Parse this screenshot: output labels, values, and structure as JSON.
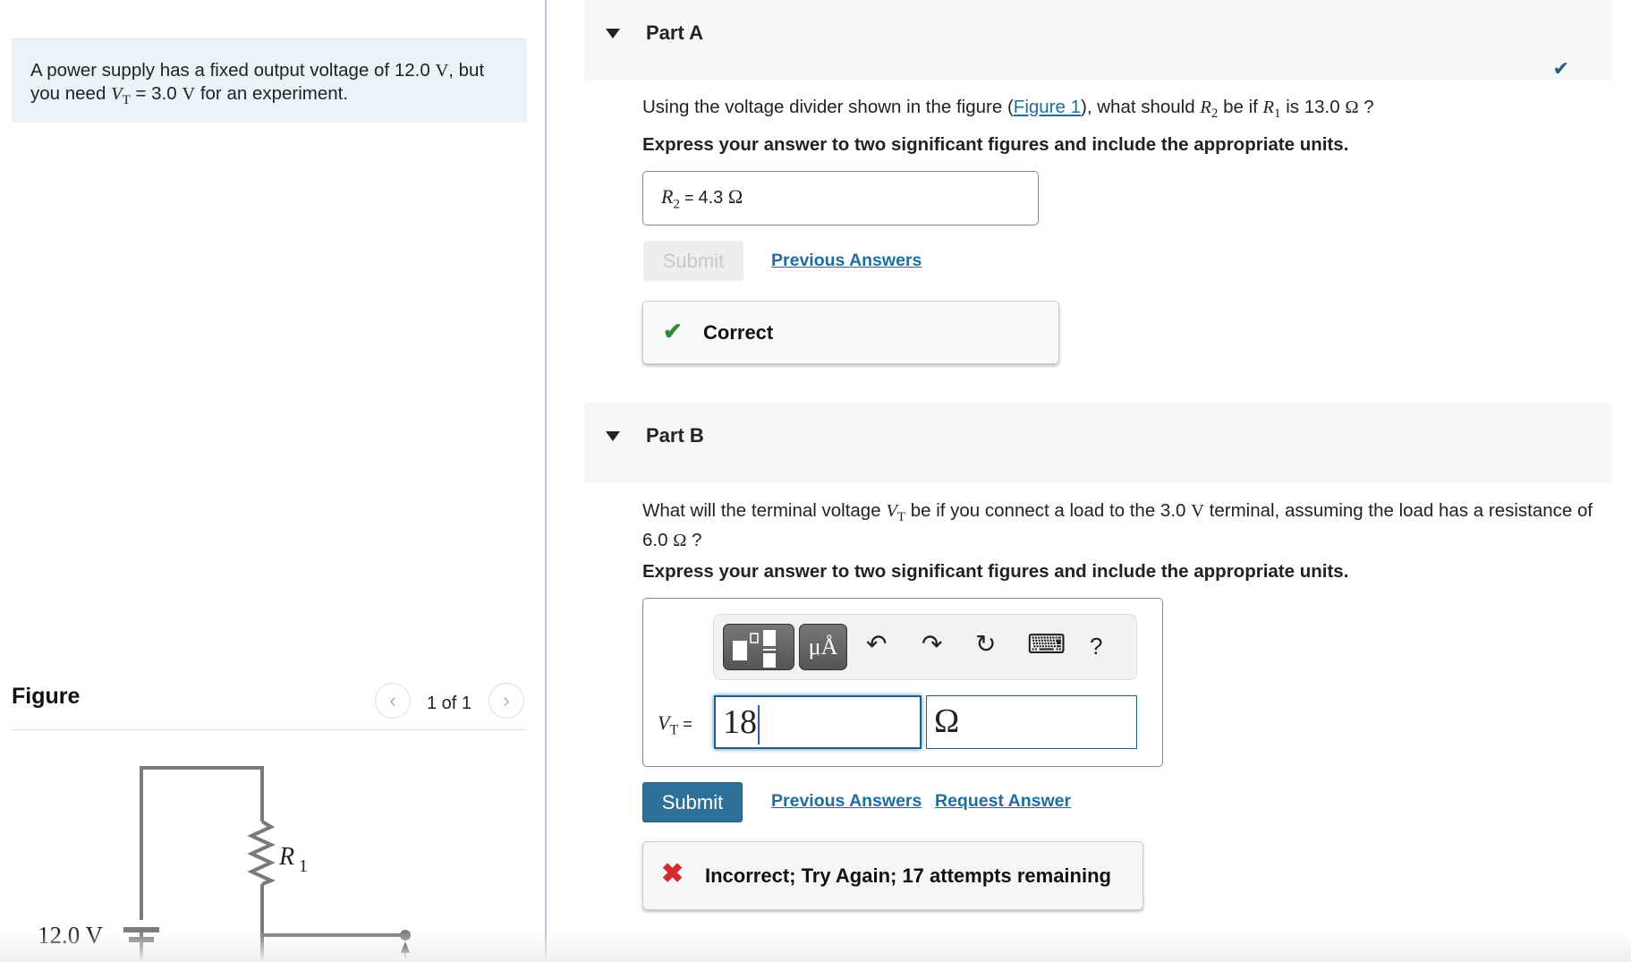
{
  "problem": {
    "intro_part1": "A power supply has a fixed output voltage of 12.0 ",
    "intro_unit1": "V",
    "intro_part2": ", but you need ",
    "intro_var": "V",
    "intro_sub": "T",
    "intro_part3": " = 3.0 ",
    "intro_unit2": "V",
    "intro_part4": " for an experiment."
  },
  "figure": {
    "title": "Figure",
    "counter": "1 of 1",
    "prev_icon": "‹",
    "next_icon": "›",
    "battery_label": "12.0 V",
    "resistor_label": "R",
    "resistor_sub": "1"
  },
  "partA": {
    "title": "Part A",
    "status_icon": "✔",
    "question_pre": "Using the voltage divider shown in the figure (",
    "question_link": "Figure 1",
    "question_mid": "), what should ",
    "var_r2": "R",
    "var_r2_sub": "2",
    "question_mid2": " be if ",
    "var_r1": "R",
    "var_r1_sub": "1",
    "question_post": " is 13.0 ",
    "question_unit": "Ω",
    "question_end": " ?",
    "instruction": "Express your answer to two significant figures and include the appropriate units.",
    "answer_var": "R",
    "answer_sub": "2",
    "answer_eq": " = ",
    "answer_value": "4.3 ",
    "answer_unit": "Ω",
    "submit_label": "Submit",
    "previous_answers_label": "Previous Answers",
    "feedback_icon": "✔",
    "feedback_text": "Correct"
  },
  "partB": {
    "title": "Part B",
    "question_pre": "What will the terminal voltage ",
    "var": "V",
    "var_sub": "T",
    "question_mid": " be if you connect a load to the 3.0 ",
    "unit_v": "V",
    "question_post": " terminal, assuming the load has a resistance of 6.0 ",
    "unit_ohm": "Ω",
    "question_end": " ?",
    "instruction": "Express your answer to two significant figures and include the appropriate units.",
    "toolbar": {
      "templates_icon": "templates-icon",
      "units_label": "μÅ",
      "undo_icon": "↶",
      "redo_icon": "↷",
      "reset_icon": "↻",
      "keyboard_icon": "⌨",
      "help_label": "?"
    },
    "answer_var": "V",
    "answer_sub": "T",
    "answer_eq": " =",
    "value_input": "18",
    "unit_input": "Ω",
    "submit_label": "Submit",
    "previous_answers_label": "Previous Answers",
    "request_answer_label": "Request Answer",
    "feedback_icon": "✖",
    "feedback_text": "Incorrect; Try Again; 17 attempts remaining"
  },
  "colors": {
    "accent": "#2f7099",
    "link": "#1d6e9e",
    "correct": "#2f8a3e",
    "incorrect": "#d42a2a",
    "intro_bg": "#e9f4f8"
  }
}
